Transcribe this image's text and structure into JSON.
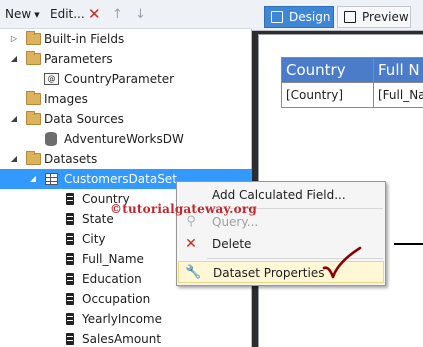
{
  "toolbar": {
    "new_label": "New",
    "edit_label": "Edit...",
    "delete_symbol": "✕",
    "up_symbol": "↑",
    "down_symbol": "↓"
  },
  "tree": {
    "built_in_fields": "Built-in Fields",
    "parameters": "Parameters",
    "country_parameter": "CountryParameter",
    "images": "Images",
    "data_sources": "Data Sources",
    "adventure_works": "AdventureWorksDW",
    "datasets": "Datasets",
    "customers_dataset": "CustomersDataSet",
    "fields": [
      "Country",
      "State",
      "City",
      "Full_Name",
      "Education",
      "Occupation",
      "YearlyIncome",
      "SalesAmount"
    ]
  },
  "tabs": {
    "design": "Design",
    "preview": "Preview"
  },
  "report_table": {
    "headers": [
      "Country",
      "Full N"
    ],
    "row": [
      "[Country]",
      "[Full_Na"
    ]
  },
  "context_menu": {
    "add_calculated_field": "Add Calculated Field...",
    "query": "Query...",
    "delete": "Delete",
    "dataset_properties": "Dataset Properties"
  },
  "watermark": "©tutorialgateway.org",
  "colors": {
    "selection": "#3399ff",
    "design_tab": "#3e86d6",
    "table_header": "#4a7cc9",
    "watermark": "#c0282d",
    "delete_icon": "#c42b1c",
    "checkmark": "#8b0000"
  },
  "icons": {
    "delete": "close-x-icon",
    "query": "query-icon",
    "properties": "wrench-icon"
  }
}
